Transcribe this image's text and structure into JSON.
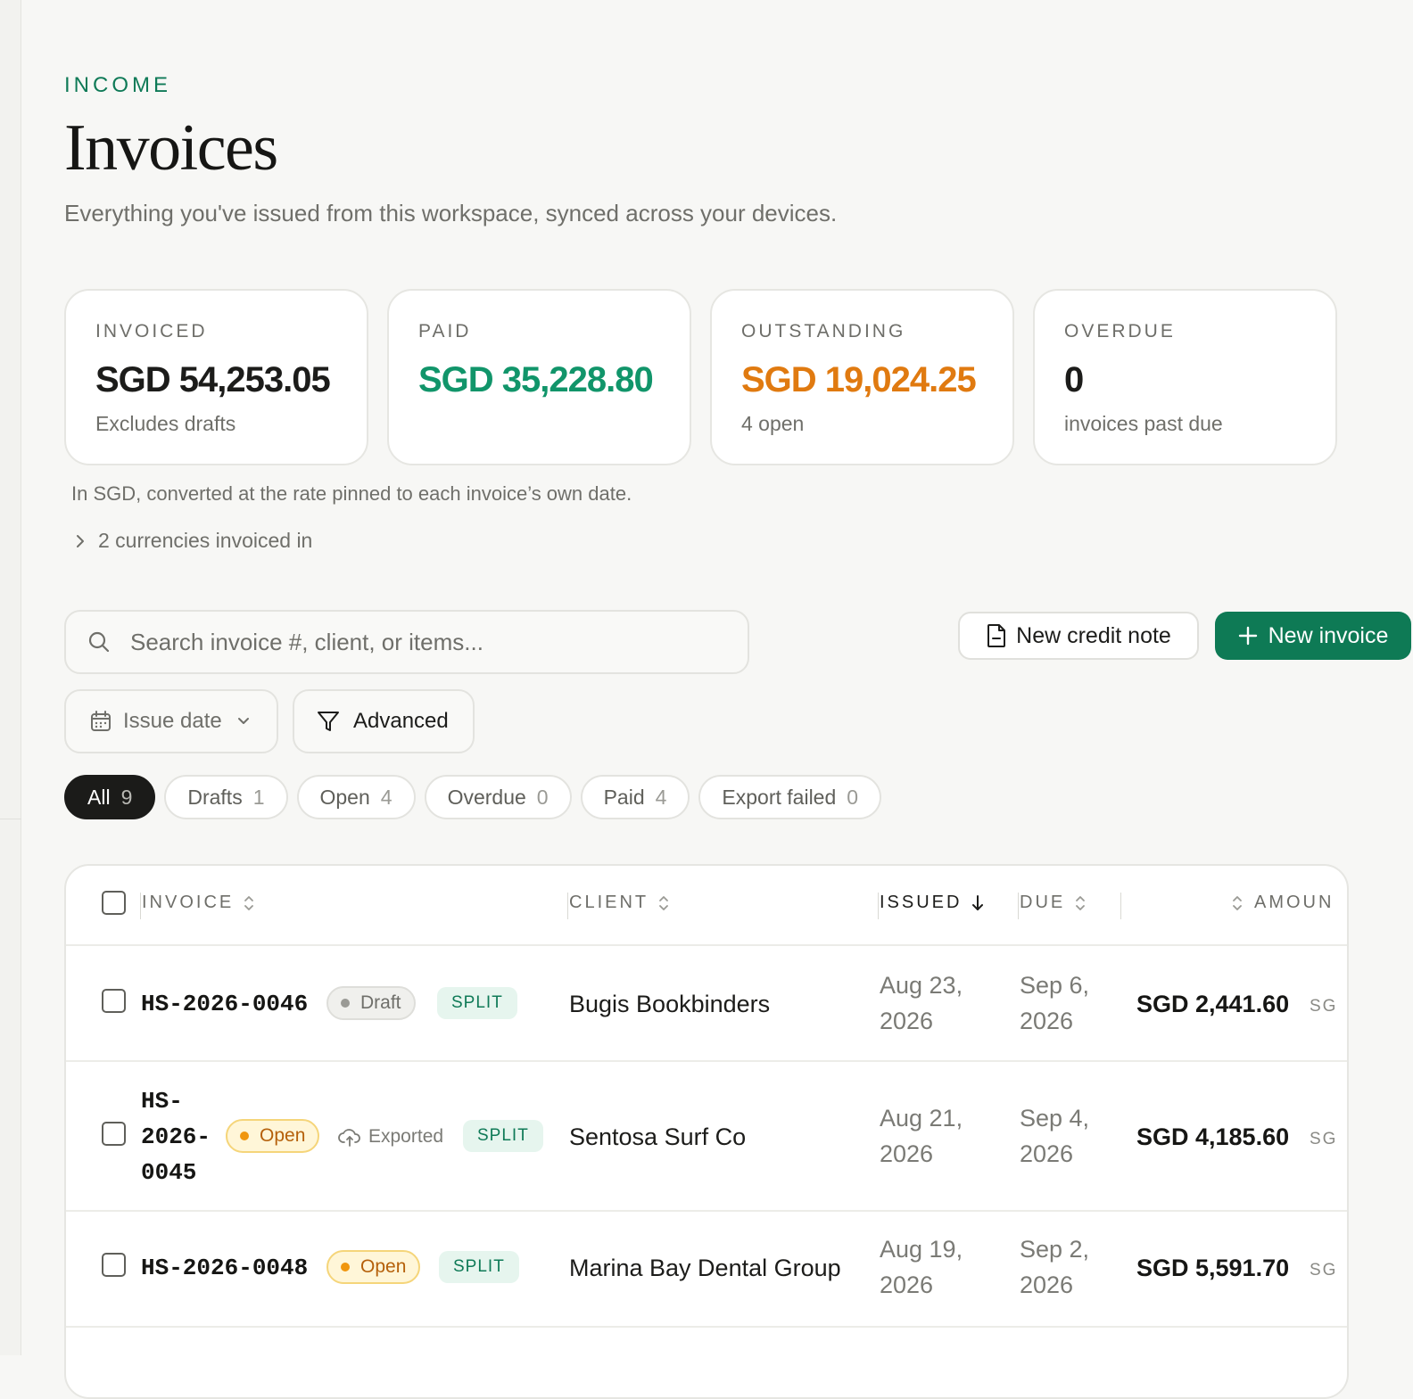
{
  "header": {
    "eyebrow": "INCOME",
    "title": "Invoices",
    "subtitle": "Everything you've issued from this workspace, synced across your devices."
  },
  "stats": [
    {
      "label": "INVOICED",
      "value": "SGD 54,253.05",
      "note": "Excludes drafts",
      "color": "#1c1c1a"
    },
    {
      "label": "PAID",
      "value": "SGD 35,228.80",
      "note": "",
      "color": "#11956a"
    },
    {
      "label": "OUTSTANDING",
      "value": "SGD 19,024.25",
      "note": "4 open",
      "color": "#e07a10"
    },
    {
      "label": "OVERDUE",
      "value": "0",
      "note": "invoices past due",
      "color": "#1c1c1a"
    }
  ],
  "fx_note": "In SGD, converted at the rate pinned to each invoice’s own date.",
  "currencies_toggle": "2 currencies invoiced in",
  "search": {
    "placeholder": "Search invoice #, client, or items..."
  },
  "actions": {
    "new_credit_note": "New credit note",
    "new_invoice": "New invoice"
  },
  "filters": {
    "issue_date": "Issue date",
    "advanced": "Advanced"
  },
  "tabs": [
    {
      "label": "All",
      "count": "9",
      "active": true
    },
    {
      "label": "Drafts",
      "count": "1"
    },
    {
      "label": "Open",
      "count": "4"
    },
    {
      "label": "Overdue",
      "count": "0"
    },
    {
      "label": "Paid",
      "count": "4"
    },
    {
      "label": "Export failed",
      "count": "0"
    }
  ],
  "table": {
    "columns": {
      "invoice": "INVOICE",
      "client": "CLIENT",
      "issued": "ISSUED",
      "due": "DUE",
      "amount": "AMOUN"
    },
    "rows": [
      {
        "number": "HS-2026-0046",
        "status": "Draft",
        "exported": "",
        "split": "SPLIT",
        "client": "Bugis Bookbinders",
        "issued": "Aug 23, 2026",
        "due": "Sep 6, 2026",
        "amount": "SGD 2,441.60",
        "currency": "SG"
      },
      {
        "number": "HS-2026-0045",
        "number_lines": [
          "HS-",
          "2026-",
          "0045"
        ],
        "status": "Open",
        "exported": "Exported",
        "split": "SPLIT",
        "client": "Sentosa Surf Co",
        "issued": "Aug 21, 2026",
        "due": "Sep 4, 2026",
        "amount": "SGD 4,185.60",
        "currency": "SG"
      },
      {
        "number": "HS-2026-0048",
        "status": "Open",
        "exported": "",
        "split": "SPLIT",
        "client": "Marina Bay Dental Group",
        "issued": "Aug 19, 2026",
        "due": "Sep 2, 2026",
        "amount": "SGD 5,591.70",
        "currency": "SG"
      }
    ]
  },
  "icons": {
    "search": "search-icon",
    "chevron_right": "chevron-right-icon",
    "document": "document-icon",
    "plus": "plus-icon",
    "calendar": "calendar-icon",
    "chevron_down": "chevron-down-icon",
    "filter": "filter-icon",
    "sort": "sort-icon",
    "arrow_down": "arrow-down-icon",
    "cloud_upload": "cloud-upload-icon"
  },
  "colors": {
    "accent": "#0e7a55",
    "paid": "#11956a",
    "outstanding": "#e07a10",
    "open_badge": "#b5600a"
  }
}
